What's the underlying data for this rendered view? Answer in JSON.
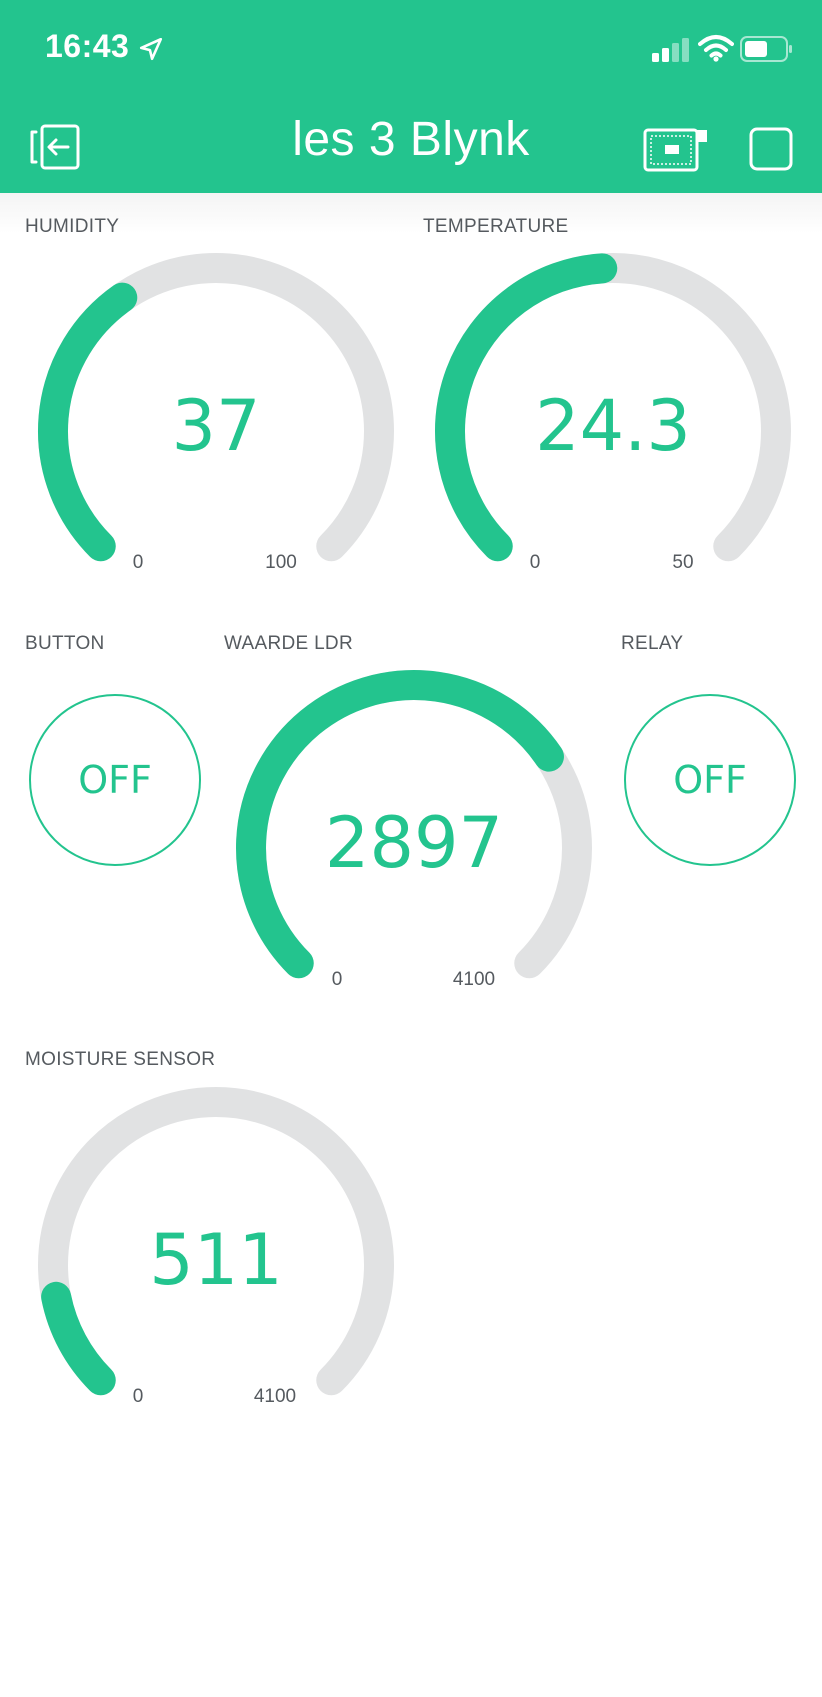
{
  "status_bar": {
    "time": "16:43",
    "icons": [
      "location-arrow-icon",
      "cellular-signal-icon",
      "wifi-icon",
      "battery-icon"
    ]
  },
  "header": {
    "title": "les 3 Blynk",
    "left_icon": "exit-icon",
    "right_icons": [
      "device-board-icon",
      "stop-icon"
    ]
  },
  "colors": {
    "accent": "#23c48e",
    "track": "#e1e2e3",
    "label": "#555a5f"
  },
  "widgets": {
    "humidity": {
      "label": "HUMIDITY",
      "value": "37",
      "min": "0",
      "max": "100",
      "level": 37
    },
    "temperature": {
      "label": "TEMPERATURE",
      "value": "24.3",
      "min": "0",
      "max": "50",
      "level": 48.6
    },
    "button": {
      "label": "BUTTON",
      "state": "OFF"
    },
    "ldr": {
      "label": "WAARDE LDR",
      "value": "2897",
      "min": "0",
      "max": "4100",
      "level": 70.7
    },
    "relay": {
      "label": "RELAY",
      "state": "OFF"
    },
    "moisture": {
      "label": "MOISTURE SENSOR",
      "value": "511",
      "min": "0",
      "max": "4100",
      "level": 12.5
    }
  }
}
